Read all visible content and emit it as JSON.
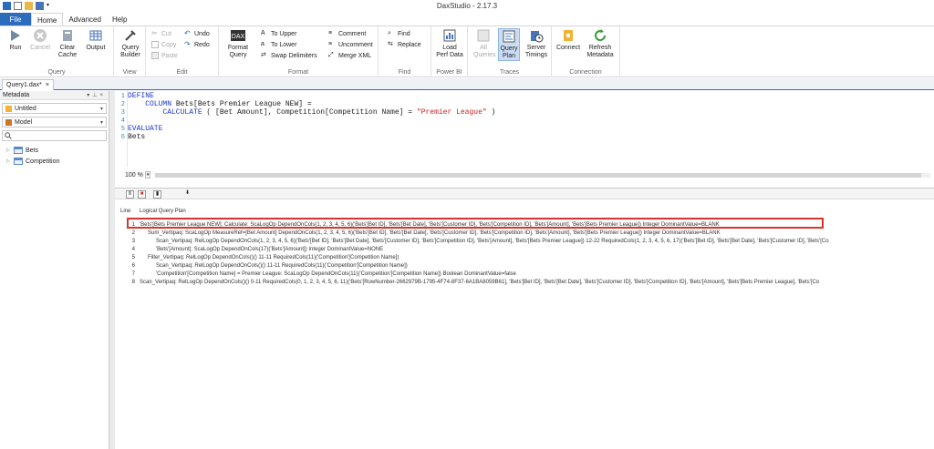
{
  "window": {
    "title": "DaxStudio - 2.17.3"
  },
  "ribbon_tabs": [
    "File",
    "Home",
    "Advanced",
    "Help"
  ],
  "ribbon": {
    "query_group": {
      "label": "Query",
      "run": "Run",
      "cancel": "Cancel",
      "clear_cache": "Clear Cache",
      "output": "Output"
    },
    "view_group": {
      "label": "View",
      "query_builder": "Query Builder"
    },
    "edit_group": {
      "label": "Edit",
      "cut": "Cut",
      "copy": "Copy",
      "paste": "Paste",
      "undo": "Undo",
      "redo": "Redo"
    },
    "format_group": {
      "label": "Format",
      "format_query": "Format Query",
      "to_upper": "To Upper",
      "to_lower": "To Lower",
      "swap_delimiters": "Swap Delimiters",
      "comment": "Comment",
      "uncomment": "Uncomment",
      "merge_xml": "Merge XML"
    },
    "find_group": {
      "label": "Find",
      "find": "Find",
      "replace": "Replace"
    },
    "powerbi_group": {
      "label": "Power BI",
      "load_perf_data": "Load Perf Data"
    },
    "traces_group": {
      "label": "Traces",
      "all_queries": "All Queries",
      "query_plan": "Query Plan",
      "server_timings": "Server Timings"
    },
    "connection_group": {
      "label": "Connection",
      "connect": "Connect",
      "refresh_metadata": "Refresh Metadata"
    }
  },
  "document_tab": {
    "label": "Query1.dax*"
  },
  "metadata": {
    "header": "Metadata",
    "database": "Untitled",
    "model": "Model",
    "tables": [
      "Bets",
      "Competition"
    ]
  },
  "editor": {
    "zoom": "100 %",
    "lines": [
      {
        "n": "1",
        "text": "DEFINE"
      },
      {
        "n": "2",
        "text": "    COLUMN Bets[Bets Premier League NEW] ="
      },
      {
        "n": "3",
        "text": "        CALCULATE ( [Bet Amount], Competition[Competition Name] = \"Premier League\" )"
      },
      {
        "n": "4",
        "text": ""
      },
      {
        "n": "5",
        "text": "EVALUATE"
      },
      {
        "n": "6",
        "text": "Bets"
      }
    ]
  },
  "results": {
    "col_line": "Line",
    "col_plan": "Logical Query Plan",
    "rows": [
      {
        "n": "1",
        "indent": 0,
        "text": "'Bets'[Bets Premier League NEW]: Calculate: ScaLogOp DependOnCols(1, 2, 3, 4, 5, 6)('Bets'[Bet ID], 'Bets'[Bet Date], 'Bets'[Customer ID], 'Bets'[Competition ID], 'Bets'[Amount], 'Bets'[Bets Premier League]) Integer DominantValue=BLANK"
      },
      {
        "n": "2",
        "indent": 1,
        "text": "Sum_Vertipaq: ScaLogOp MeasureRef=[Bet Amount] DependOnCols(1, 2, 3, 4, 5, 6)('Bets'[Bet ID], 'Bets'[Bet Date], 'Bets'[Customer ID], 'Bets'[Competition ID], 'Bets'[Amount], 'Bets'[Bets Premier League]) Integer DominantValue=BLANK"
      },
      {
        "n": "3",
        "indent": 2,
        "text": "Scan_Vertipaq: RelLogOp DependOnCols(1, 2, 3, 4, 5, 6)('Bets'[Bet ID], 'Bets'[Bet Date], 'Bets'[Customer ID], 'Bets'[Competition ID], 'Bets'[Amount], 'Bets'[Bets Premier League]) 12-22 RequiredCols(1, 2, 3, 4, 5, 6, 17)('Bets'[Bet ID], 'Bets'[Bet Date], 'Bets'[Customer ID], 'Bets'[Co"
      },
      {
        "n": "4",
        "indent": 2,
        "text": "'Bets'[Amount]: ScaLogOp DependOnCols(17)('Bets'[Amount]) Integer DominantValue=NONE"
      },
      {
        "n": "5",
        "indent": 1,
        "text": "Filter_Vertipaq: RelLogOp DependOnCols()() 11-11 RequiredCols(11)('Competition'[Competition Name])"
      },
      {
        "n": "6",
        "indent": 2,
        "text": "Scan_Vertipaq: RelLogOp DependOnCols()() 11-11 RequiredCols(11)('Competition'[Competition Name])"
      },
      {
        "n": "7",
        "indent": 2,
        "text": "'Competition'[Competition Name] = Premier League: ScaLogOp DependOnCols(11)('Competition'[Competition Name]) Boolean DominantValue=false"
      },
      {
        "n": "8",
        "indent": 0,
        "text": "Scan_Vertipaq: RelLogOp DependOnCols()() 0-11 RequiredCols(0, 1, 2, 3, 4, 5, 6, 11)('Bets'[RowNumber-2662979B-1795-4F74-8F37-6A1BA8059B61], 'Bets'[Bet ID], 'Bets'[Bet Date], 'Bets'[Customer ID], 'Bets'[Competition ID], 'Bets'[Amount], 'Bets'[Bets Premier League], 'Bets'[Co"
      }
    ]
  },
  "colors": {
    "accent": "#2b6cbd",
    "highlight": "#d9342b",
    "keyword": "#1a35c9",
    "string": "#d01b1b"
  }
}
